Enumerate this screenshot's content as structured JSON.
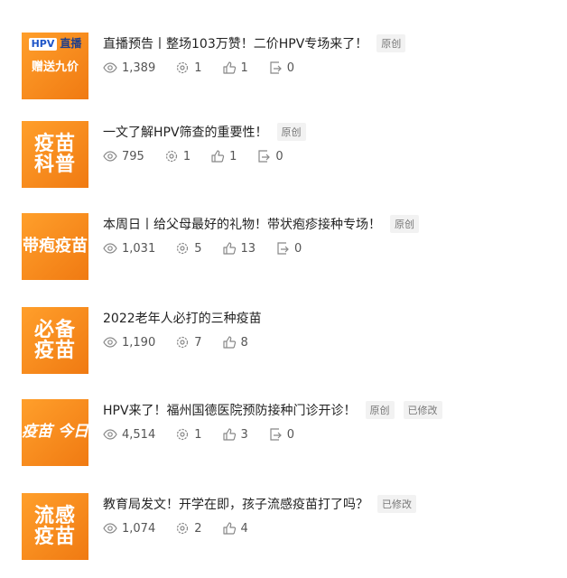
{
  "articles": [
    {
      "thumb": {
        "line1": "HPV 直播",
        "tag": "HPV",
        "live": "直播",
        "line2": "赠送九价"
      },
      "title": "直播预告丨整场103万赞！二价HPV专场来了！",
      "badges": [
        "原创"
      ],
      "views": "1,389",
      "shares": "1",
      "likes": "1",
      "forwards": "0"
    },
    {
      "thumb": {
        "line1": "疫苗",
        "line2": "科普"
      },
      "title": "一文了解HPV筛查的重要性！",
      "badges": [
        "原创"
      ],
      "views": "795",
      "shares": "1",
      "likes": "1",
      "forwards": "0"
    },
    {
      "thumb": {
        "line1": "带疱疫苗"
      },
      "title": "本周日丨给父母最好的礼物！带状疱疹接种专场！",
      "badges": [
        "原创"
      ],
      "views": "1,031",
      "shares": "5",
      "likes": "13",
      "forwards": "0"
    },
    {
      "thumb": {
        "line1": "必备",
        "line2": "疫苗"
      },
      "title": "2022老年人必打的三种疫苗",
      "badges": [],
      "views": "1,190",
      "shares": "7",
      "likes": "8"
    },
    {
      "thumb": {
        "line1": "疫苗 今日"
      },
      "title": "HPV来了！福州国德医院预防接种门诊开诊！",
      "badges": [
        "原创",
        "已修改"
      ],
      "views": "4,514",
      "shares": "1",
      "likes": "3",
      "forwards": "0"
    },
    {
      "thumb": {
        "line1": "流感",
        "line2": "疫苗"
      },
      "title": "教育局发文！开学在即，孩子流感疫苗打了吗？",
      "badges": [
        "已修改"
      ],
      "views": "1,074",
      "shares": "2",
      "likes": "4"
    }
  ],
  "icons": {
    "views": "eye-icon",
    "shares": "gear-share-icon",
    "likes": "thumbs-up-icon",
    "forwards": "forward-icon"
  },
  "colors": {
    "thumb_orange": "#f28a1c",
    "text": "#222222",
    "muted": "#555555",
    "badge_bg": "#f2f2f2"
  }
}
